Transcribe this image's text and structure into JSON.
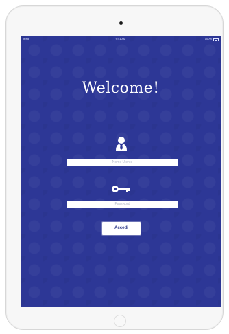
{
  "status_bar": {
    "left": "iPad",
    "time": "9:41 AM",
    "right": "100%"
  },
  "welcome": {
    "title": "Welcome!"
  },
  "login": {
    "username_placeholder": "Nome Utente",
    "password_placeholder": "Password",
    "submit_label": "Accedi"
  },
  "icons": {
    "user": "user-icon",
    "key": "key-icon",
    "camera": "camera-icon",
    "home": "home-button-icon",
    "battery": "battery-icon"
  },
  "colors": {
    "background": "#2d3796",
    "text": "#ffffff",
    "button_text": "#253184"
  }
}
